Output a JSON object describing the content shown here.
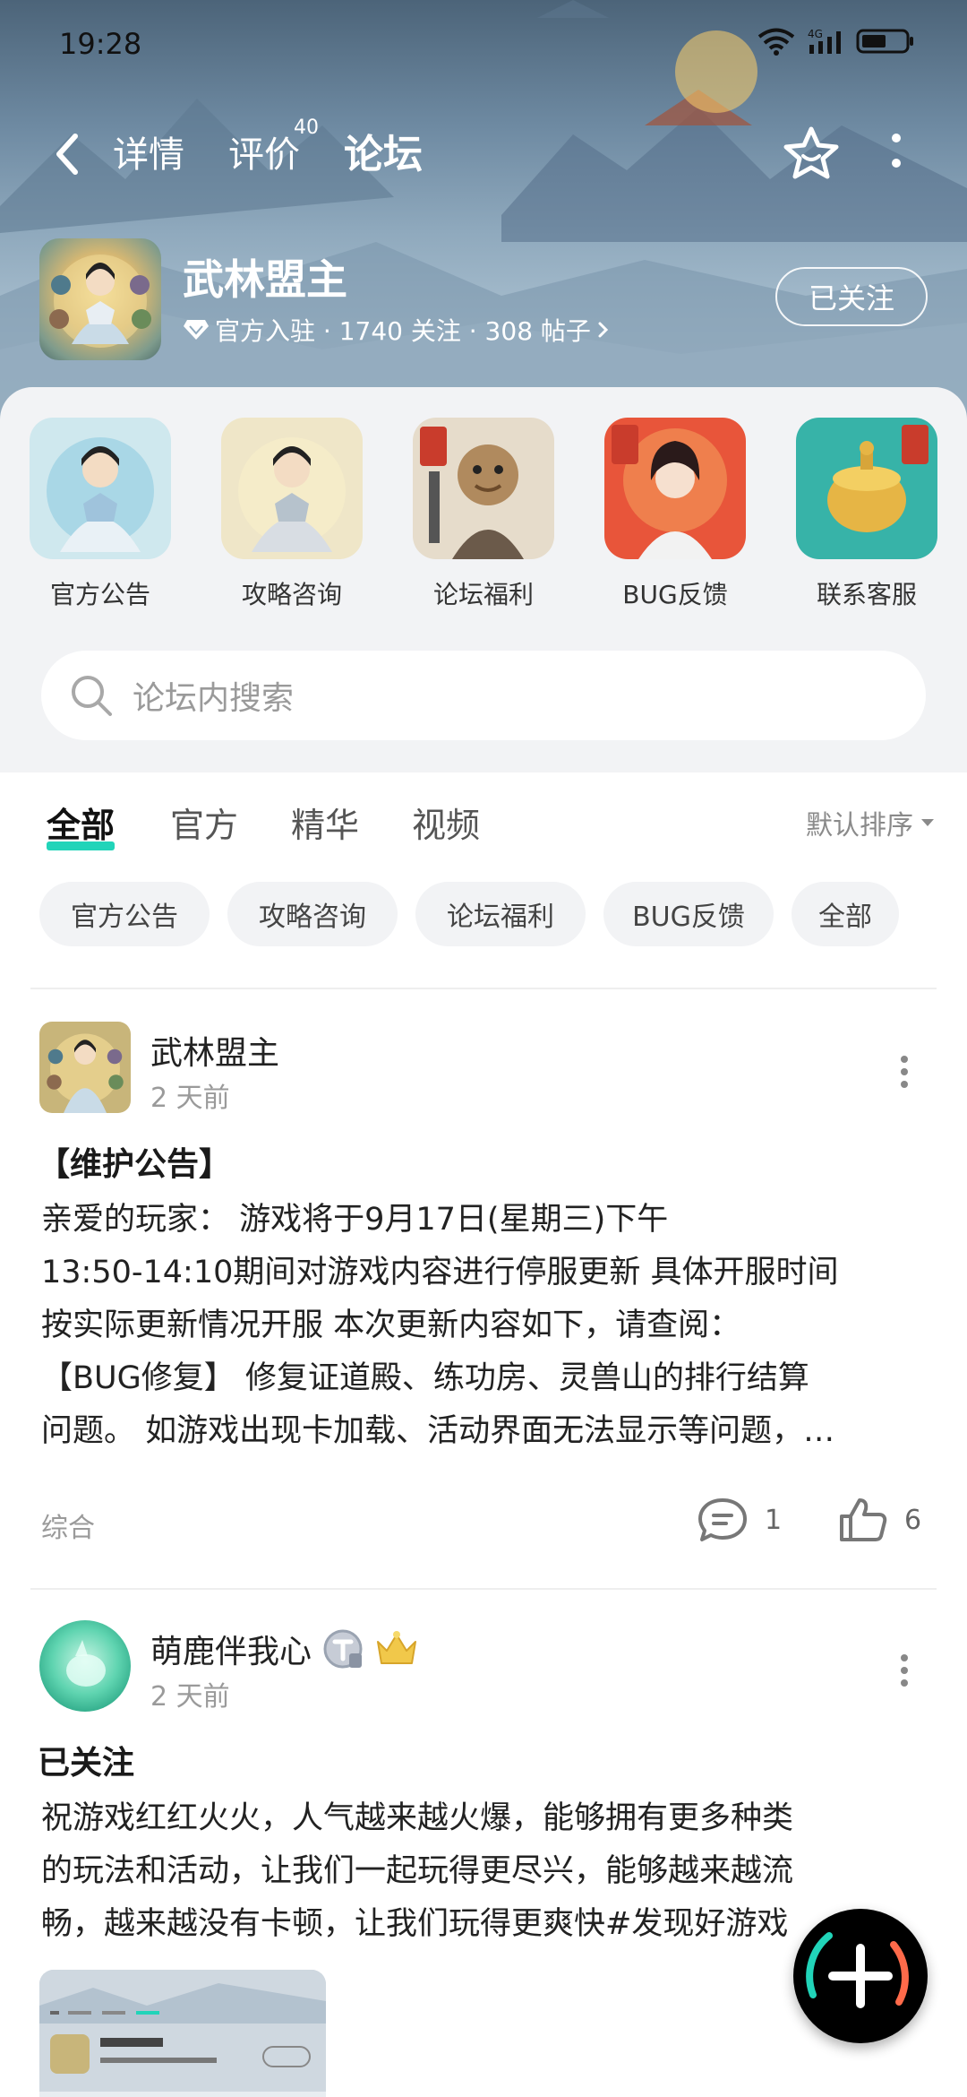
{
  "status": {
    "time": "19:28",
    "network": "4G"
  },
  "nav": {
    "tabs": [
      "详情",
      "评价",
      "论坛"
    ],
    "review_badge": "40",
    "active_tab": "论坛"
  },
  "game": {
    "name": "武林盟主",
    "meta": "官方入驻 · 1740 关注 · 308 帖子",
    "follow_label": "已关注"
  },
  "quick_links": [
    {
      "label": "官方公告"
    },
    {
      "label": "攻略咨询"
    },
    {
      "label": "论坛福利"
    },
    {
      "label": "BUG反馈"
    },
    {
      "label": "联系客服"
    }
  ],
  "search": {
    "placeholder": "论坛内搜索"
  },
  "filter_tabs": [
    "全部",
    "官方",
    "精华",
    "视频"
  ],
  "sort_label": "默认排序",
  "chips": [
    "官方公告",
    "攻略咨询",
    "论坛福利",
    "BUG反馈",
    "全部"
  ],
  "posts": [
    {
      "author": "武林盟主",
      "time": "2 天前",
      "title": "【维护公告】",
      "lines": [
        "亲爱的玩家：  游戏将于9月17日(星期三)下午",
        "13:50-14:10期间对游戏内容进行停服更新 具体开服时间",
        "按实际更新情况开服 本次更新内容如下，请查阅：",
        "【BUG修复】 修复证道殿、练功房、灵兽山的排行结算",
        "问题。 如游戏出现卡加载、活动界面无法显示等问题，…"
      ],
      "category": "综合",
      "comments": "1",
      "likes": "6"
    },
    {
      "author": "萌鹿伴我心",
      "time": "2 天前",
      "title": "已关注",
      "lines": [
        "祝游戏红红火火，人气越来越火爆，能够拥有更多种类",
        "的玩法和活动，让我们一起玩得更尽兴，能够越来越流",
        "畅，越来越没有卡顿，让我们玩得更爽快#发现好游戏"
      ]
    }
  ],
  "colors": {
    "accent": "#21d4b9"
  }
}
